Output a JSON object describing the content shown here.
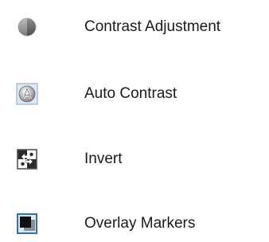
{
  "items": [
    {
      "label": "Contrast Adjustment",
      "icon": "contrast-adjustment-icon"
    },
    {
      "label": "Auto Contrast",
      "icon": "auto-contrast-icon"
    },
    {
      "label": "Invert",
      "icon": "invert-icon"
    },
    {
      "label": "Overlay Markers",
      "icon": "overlay-markers-icon"
    }
  ],
  "colors": {
    "text": "#1a1a1a",
    "icon_blue_frame": "#2f6fb8",
    "icon_light_blue": "#a9c9ea",
    "icon_gray": "#8a8a8a"
  }
}
